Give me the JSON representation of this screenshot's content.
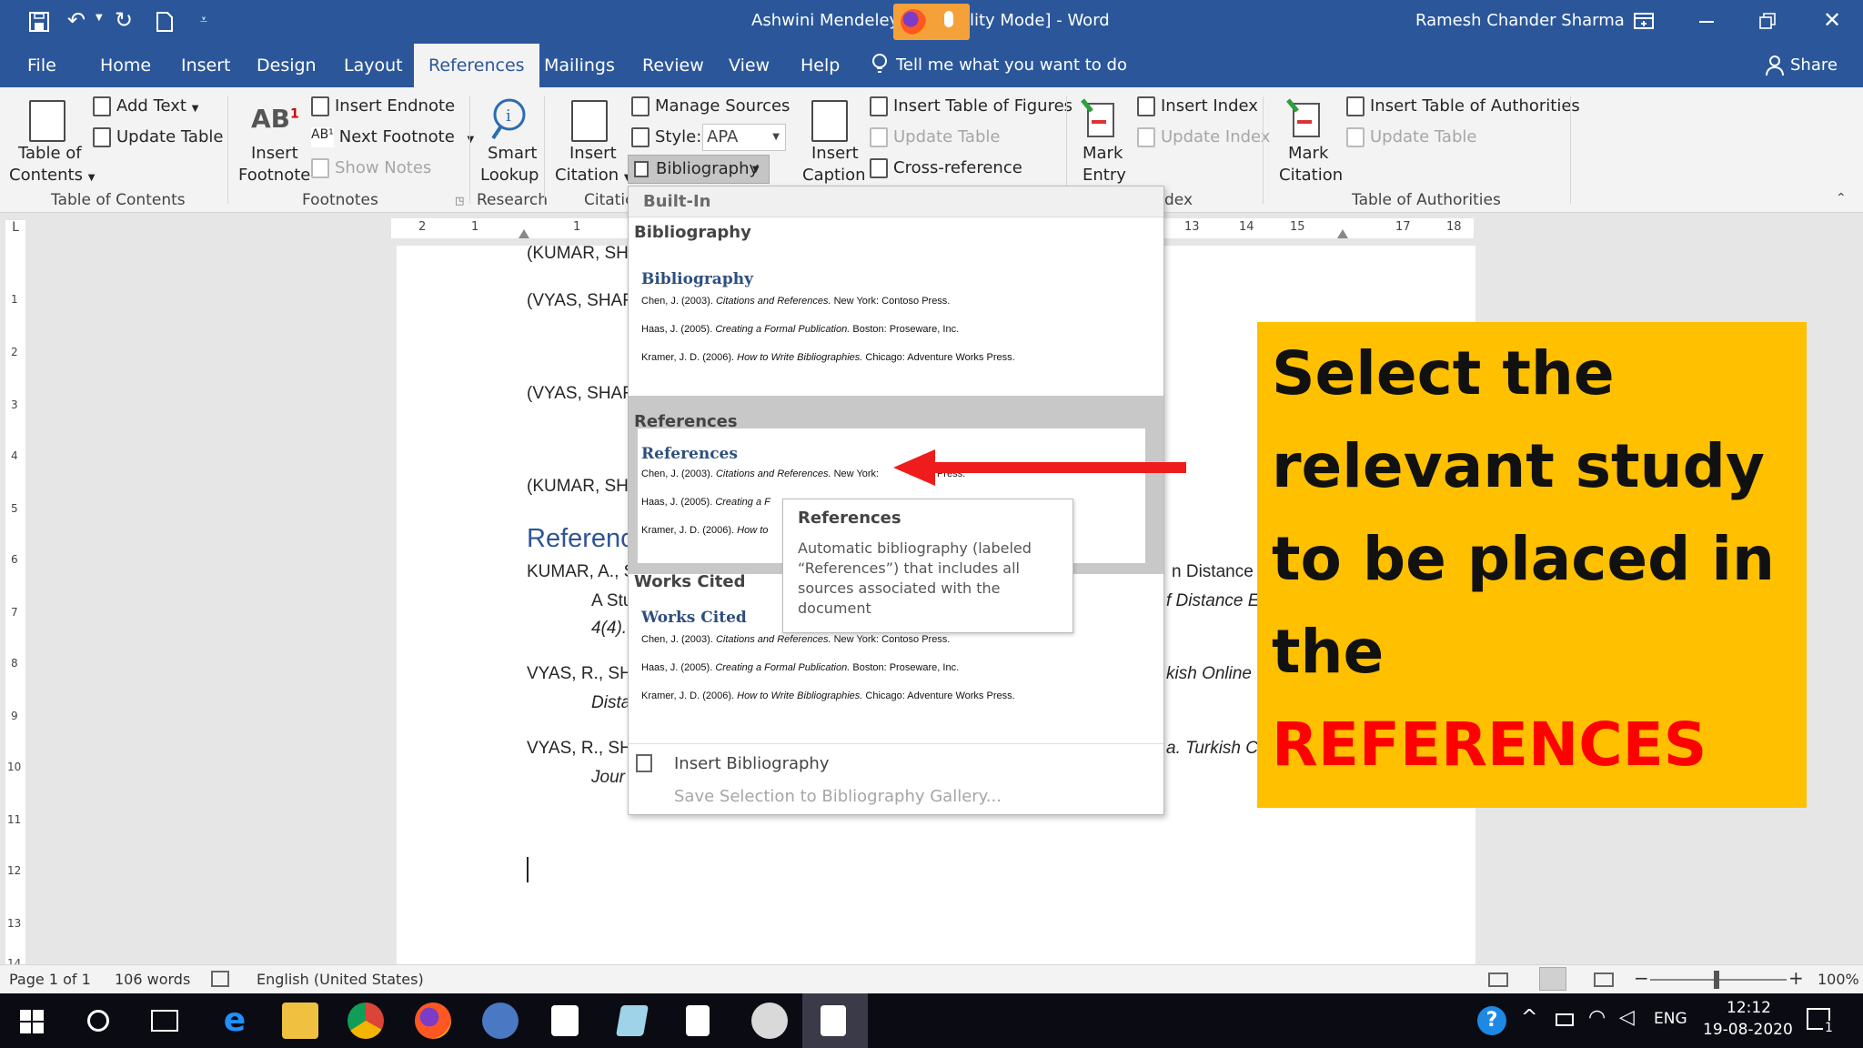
{
  "titlebar": {
    "title": "Ashwini Mendeley [",
    "title_suffix": "lity Mode]  -  Word",
    "user": "Ramesh Chander Sharma"
  },
  "tabs": [
    "File",
    "Home",
    "Insert",
    "Design",
    "Layout",
    "References",
    "Mailings",
    "Review",
    "View",
    "Help"
  ],
  "tellme": "Tell me what you want to do",
  "share": "Share",
  "ribbon": {
    "toc": {
      "label": "Table of",
      "label2": "Contents",
      "add_text": "Add Text",
      "update_table": "Update Table",
      "group": "Table of Contents"
    },
    "footnotes": {
      "insert_footnote": "Insert",
      "insert_footnote2": "Footnote",
      "insert_endnote": "Insert Endnote",
      "next_footnote": "Next Footnote",
      "show_notes": "Show Notes",
      "group": "Footnotes"
    },
    "research": {
      "smart_lookup": "Smart",
      "smart_lookup2": "Lookup",
      "group": "Research"
    },
    "citations": {
      "insert_citation": "Insert",
      "insert_citation2": "Citation",
      "manage_sources": "Manage Sources",
      "style_label": "Style:",
      "style_value": "APA",
      "bibliography": "Bibliography",
      "group": "Citatic"
    },
    "captions": {
      "insert_caption": "Insert",
      "insert_caption2": "Caption",
      "insert_table_figures": "Insert Table of Figures",
      "update_table": "Update Table",
      "cross_reference": "Cross-reference"
    },
    "index": {
      "mark_entry": "Mark",
      "mark_entry2": "Entry",
      "insert_index": "Insert Index",
      "update_index": "Update Index",
      "group": "dex"
    },
    "authorities": {
      "mark_citation": "Mark",
      "mark_citation2": "Citation",
      "insert_toa": "Insert Table of Authorities",
      "update_table": "Update Table",
      "group": "Table of Authorities"
    }
  },
  "ruler": {
    "left": [
      "2",
      "1",
      "1"
    ],
    "right": [
      "13",
      "14",
      "15",
      "17",
      "18"
    ]
  },
  "vruler": [
    "1",
    "2",
    "3",
    "4",
    "5",
    "6",
    "7",
    "8",
    "9",
    "10",
    "11",
    "12",
    "13",
    "14"
  ],
  "document": {
    "lines": [
      "(KUMAR, SH",
      "(VYAS, SHAR",
      "(VYAS, SHAR",
      "(KUMAR, SH"
    ],
    "heading": "Referenc",
    "refs": [
      "KUMAR, A., S",
      "A Stu",
      "4(4).",
      "VYAS, R., SHA",
      "Dista",
      "VYAS, R., SHA",
      "Jour"
    ],
    "right_frag": [
      "n Distance E",
      "f Distance Ed",
      "kish Online",
      "a. Turkish C"
    ]
  },
  "dropdown": {
    "builtin": "Built-In",
    "sections": [
      {
        "head": "Bibliography",
        "title": "Bibliography"
      },
      {
        "head": "References",
        "title": "References"
      },
      {
        "head": "Works Cited",
        "title": "Works Cited"
      }
    ],
    "entries": [
      {
        "author": "Chen, J. (2003).",
        "title": "Citations and References.",
        "pub": "New York: Contoso Press."
      },
      {
        "author": "Haas, J. (2005).",
        "title": "Creating a Formal Publication.",
        "pub": "Boston: Proseware, Inc."
      },
      {
        "author": "Kramer, J. D. (2006).",
        "title": "How to Write Bibliographies.",
        "pub": "Chicago: Adventure Works Press."
      }
    ],
    "ref_trunc": {
      "l1": "New York:",
      "l1b": "oso Press.",
      "l2": "Haas, J. (2005).",
      "l2b": "Creating a F",
      "l3": "Kramer, J. D. (2006).",
      "l3b": "How to"
    },
    "insert_bibliography": "Insert Bibliography",
    "save_selection": "Save Selection to Bibliography Gallery..."
  },
  "tooltip": {
    "title": "References",
    "body1": "Automatic bibliography (labeled",
    "body2": "“References”) that includes all",
    "body3": "sources associated with the",
    "body4": "document"
  },
  "callout": {
    "lines": [
      "Select the",
      "relevant study",
      "to be placed in",
      "the"
    ],
    "highlight": "REFERENCES",
    "bg": "#ffc000",
    "highlight_color": "#ff0000"
  },
  "arrow_color": "#ee1c1c",
  "statusbar": {
    "page": "Page 1 of 1",
    "words": "106 words",
    "language": "English (United States)",
    "zoom": "100%"
  },
  "taskbar": {
    "lang": "ENG",
    "time": "12:12",
    "date": "19-08-2020",
    "notif": "1"
  }
}
